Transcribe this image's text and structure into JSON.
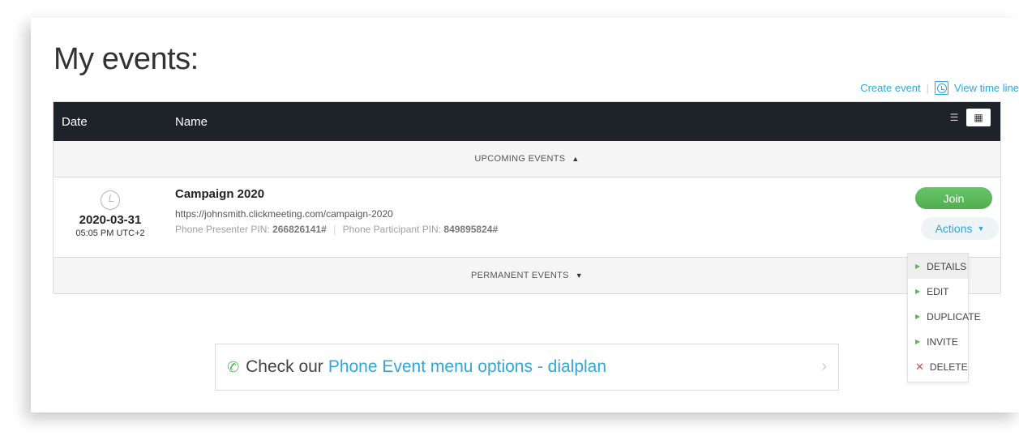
{
  "page": {
    "title": "My events:"
  },
  "top_links": {
    "create_event": "Create event",
    "separator": "|",
    "view_timeline": "View time line"
  },
  "table": {
    "headers": {
      "date": "Date",
      "name": "Name"
    },
    "view_toggle": {
      "list_icon": "list-icon",
      "calendar_icon": "calendar-icon",
      "selected": "calendar"
    },
    "upcoming_label": "UPCOMING EVENTS",
    "upcoming_arrow": "▲",
    "permanent_label": "PERMANENT EVENTS",
    "permanent_arrow": "▼"
  },
  "event": {
    "date": "2020-03-31",
    "time": "05:05 PM UTC+2",
    "title": "Campaign 2020",
    "url": "https://johnsmith.clickmeeting.com/campaign-2020",
    "presenter_label": "Phone Presenter PIN:",
    "presenter_pin": "266826141#",
    "pin_separator": "|",
    "participant_label": "Phone Participant PIN:",
    "participant_pin": "849895824#",
    "join_label": "Join",
    "actions_label": "Actions"
  },
  "actions_menu": {
    "items": [
      {
        "label": "DETAILS",
        "active": true
      },
      {
        "label": "EDIT",
        "active": false
      },
      {
        "label": "DUPLICATE",
        "active": false
      },
      {
        "label": "INVITE",
        "active": false
      },
      {
        "label": "DELETE",
        "active": false
      }
    ]
  },
  "promo": {
    "prefix": "Check our",
    "link": "Phone Event menu options - dialplan"
  },
  "colors": {
    "accent": "#2fa8d9",
    "success": "#5cb85c",
    "danger": "#e04a3f",
    "header_bg": "#1e2329"
  }
}
